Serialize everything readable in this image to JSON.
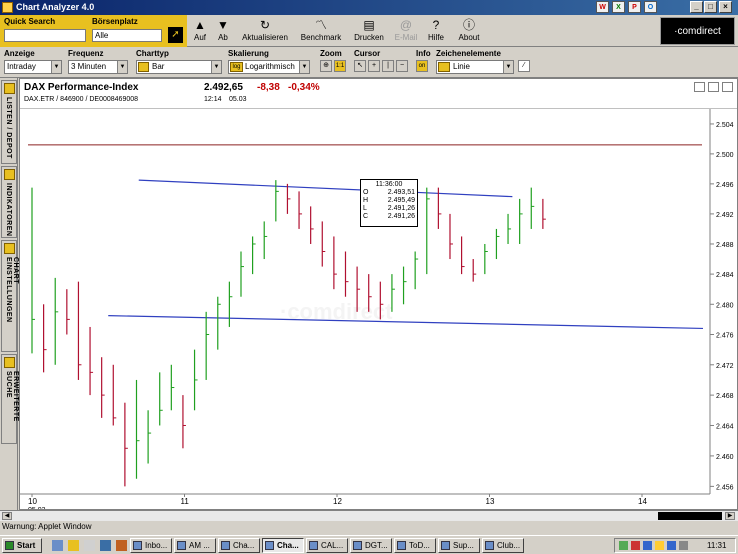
{
  "window": {
    "title": "Chart Analyzer 4.0"
  },
  "quick_search": {
    "label": "Quick Search",
    "value": ""
  },
  "boersenplatz": {
    "label": "Börsenplatz",
    "value": "Alle"
  },
  "toolbar": {
    "auf": "Auf",
    "ab": "Ab",
    "aktualisieren": "Aktualisieren",
    "benchmark": "Benchmark",
    "drucken": "Drucken",
    "email": "E-Mail",
    "hilfe": "Hilfe",
    "about": "About"
  },
  "logo": "·comdirect",
  "options": {
    "anzeige": {
      "label": "Anzeige",
      "value": "Intraday"
    },
    "frequenz": {
      "label": "Frequenz",
      "value": "3 Minuten"
    },
    "charttyp": {
      "label": "Charttyp",
      "value": "Bar"
    },
    "skalierung": {
      "label": "Skalierung",
      "value": "Logarithmisch",
      "prefix": "log"
    },
    "zoom": {
      "label": "Zoom",
      "value": "1:1"
    },
    "cursor": {
      "label": "Cursor"
    },
    "info": {
      "label": "Info",
      "value": "on"
    },
    "zeichenelemente": {
      "label": "Zeichenelemente",
      "value": "Linie"
    }
  },
  "sidebar": {
    "tabs": [
      "LISTEN / DEPOT",
      "INDIKATOREN",
      "CHART EINSTELLUNGEN",
      "ERWEITERTE SUCHE"
    ]
  },
  "instrument": {
    "name": "DAX Performance-Index",
    "sub": "DAX.ETR / 846900 / DE0008469008",
    "price": "2.492,65",
    "change": "-8,38",
    "pct": "-0,34%",
    "time": "12:14",
    "date": "05.03"
  },
  "tooltip": {
    "time": "11:36:00",
    "O": "2.493,51",
    "H": "2.495,49",
    "L": "2.491,26",
    "C": "2.491,26"
  },
  "chart_data": {
    "type": "bar",
    "y_ticks": [
      "2.504",
      "2.500",
      "2.496",
      "2.492",
      "2.488",
      "2.484",
      "2.480",
      "2.476",
      "2.472",
      "2.468",
      "2.464",
      "2.460",
      "2.456"
    ],
    "x_ticks": [
      {
        "day": "10",
        "sub": "05.03"
      },
      {
        "day": "11",
        "sub": ""
      },
      {
        "day": "12",
        "sub": ""
      },
      {
        "day": "13",
        "sub": ""
      },
      {
        "day": "14",
        "sub": ""
      }
    ],
    "ylim": [
      2455,
      2506
    ],
    "scale": "log",
    "grid": false,
    "reference_line": 2501.2,
    "trend_upper": [
      [
        10.7,
        2496.5
      ],
      [
        13.15,
        2494.3
      ]
    ],
    "trend_lower": [
      [
        10.5,
        2478.5
      ],
      [
        14.4,
        2476.8
      ]
    ],
    "bars": [
      [
        2495.5,
        2473.5,
        2478
      ],
      [
        2480,
        2471,
        2474
      ],
      [
        2483.5,
        2472,
        2479
      ],
      [
        2482,
        2476,
        2478
      ],
      [
        2483,
        2470,
        2472
      ],
      [
        2477,
        2468,
        2471
      ],
      [
        2473,
        2465,
        2468
      ],
      [
        2472,
        2464,
        2465
      ],
      [
        2467,
        2456,
        2461
      ],
      [
        2470,
        2457,
        2462
      ],
      [
        2466,
        2459,
        2463
      ],
      [
        2471,
        2464,
        2466
      ],
      [
        2472,
        2466,
        2469
      ],
      [
        2468,
        2461,
        2464
      ],
      [
        2474,
        2466,
        2470
      ],
      [
        2479,
        2470,
        2476
      ],
      [
        2481,
        2474,
        2480
      ],
      [
        2483,
        2477,
        2481
      ],
      [
        2487,
        2481,
        2485
      ],
      [
        2489,
        2484,
        2488
      ],
      [
        2491,
        2486,
        2489
      ],
      [
        2496.5,
        2491,
        2495
      ],
      [
        2496,
        2492,
        2494
      ],
      [
        2495,
        2490,
        2492
      ],
      [
        2493,
        2488,
        2490
      ],
      [
        2491,
        2485,
        2487
      ],
      [
        2489,
        2482,
        2484
      ],
      [
        2487,
        2481,
        2483
      ],
      [
        2485,
        2479,
        2482
      ],
      [
        2484,
        2479,
        2481
      ],
      [
        2483,
        2478,
        2480
      ],
      [
        2484,
        2479,
        2482
      ],
      [
        2485,
        2480,
        2483
      ],
      [
        2487,
        2482,
        2486
      ],
      [
        2495.5,
        2484,
        2494
      ],
      [
        2495.5,
        2490,
        2492
      ],
      [
        2492,
        2486,
        2488
      ],
      [
        2489,
        2484,
        2485
      ],
      [
        2486,
        2483,
        2484
      ],
      [
        2488,
        2484,
        2487
      ],
      [
        2490,
        2486,
        2489
      ],
      [
        2492,
        2488,
        2490
      ],
      [
        2494,
        2488,
        2492
      ],
      [
        2495.5,
        2490,
        2493
      ],
      [
        2494,
        2490,
        2491.3
      ]
    ]
  },
  "status_text": "Warnung: Applet Window",
  "taskbar": {
    "start": "Start",
    "tasks": [
      "Inbo...",
      "AM ...",
      "Cha...",
      "Cha...",
      "CAL...",
      "DGT...",
      "ToD...",
      "Sup...",
      "Club..."
    ],
    "clock": "11:31"
  }
}
